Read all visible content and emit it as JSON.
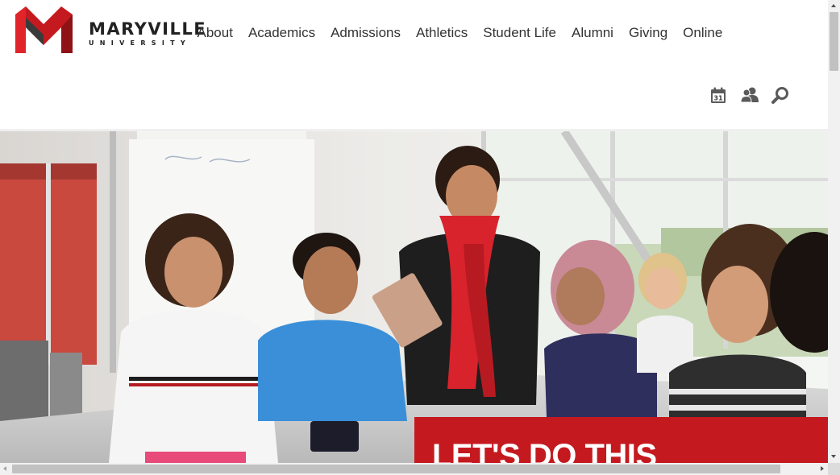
{
  "brand": {
    "name": "MARYVILLE",
    "subtitle": "UNIVERSITY",
    "color": "#c41a1f"
  },
  "nav": {
    "items": [
      {
        "label": "About"
      },
      {
        "label": "Academics"
      },
      {
        "label": "Admissions"
      },
      {
        "label": "Athletics"
      },
      {
        "label": "Student Life"
      },
      {
        "label": "Alumni"
      },
      {
        "label": "Giving"
      },
      {
        "label": "Online"
      }
    ]
  },
  "utility": {
    "calendar_day": "31",
    "icons": [
      "calendar-icon",
      "people-icon",
      "search-icon"
    ]
  },
  "hero": {
    "headline": "LET'S DO THIS",
    "banner_color": "#c41a1f",
    "image": "photo-classroom-students-and-instructor"
  }
}
